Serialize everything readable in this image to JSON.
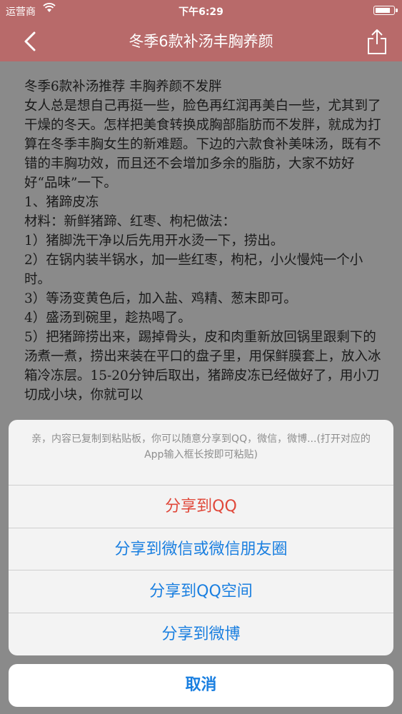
{
  "status": {
    "carrier": "运营商",
    "time": "下午6:29",
    "battery_level": 0.85
  },
  "nav": {
    "title": "冬季6款补汤丰胸养颜"
  },
  "article": {
    "lines": [
      "冬季6款补汤推荐 丰胸养颜不发胖",
      "女人总是想自己再挺一些，脸色再红润再美白一些，尤其到了干燥的冬天。怎样把美食转换成胸部脂肪而不发胖，就成为打算在冬季丰胸女生的新难题。下边的六款食补美味汤，既有不错的丰胸功效，而且还不会增加多余的脂肪，大家不妨好好“品味”一下。",
      "1、猪蹄皮冻",
      "材料：新鲜猪蹄、红枣、枸杞做法：",
      "1）猪脚洗干净以后先用开水烫一下，捞出。",
      "2）在锅内装半锅水，加一些红枣，枸杞，小火慢炖一个小时。",
      "3）等汤变黄色后，加入盐、鸡精、葱末即可。",
      "4）盛汤到碗里，趁热喝了。",
      "5）把猪蹄捞出来，踢掉骨头，皮和肉重新放回锅里跟剩下的汤煮一煮，捞出来装在平口的盘子里，用保鲜膜套上，放入冰箱冷冻层。15-20分钟后取出，猪蹄皮冻已经做好了，用小刀切成小块，你就可以"
    ]
  },
  "sheet": {
    "message": "亲，内容已复制到粘贴板，你可以随意分享到QQ，微信，微博...(打开对应的App输入框长按即可粘贴)",
    "share_qq": "分享到QQ",
    "share_wechat": "分享到微信或微信朋友圈",
    "share_qzone": "分享到QQ空间",
    "share_weibo": "分享到微博",
    "cancel": "取消"
  },
  "colors": {
    "nav_bg": "#b86a6a",
    "action_blue": "#1a7fe0",
    "action_red": "#e0483a"
  }
}
